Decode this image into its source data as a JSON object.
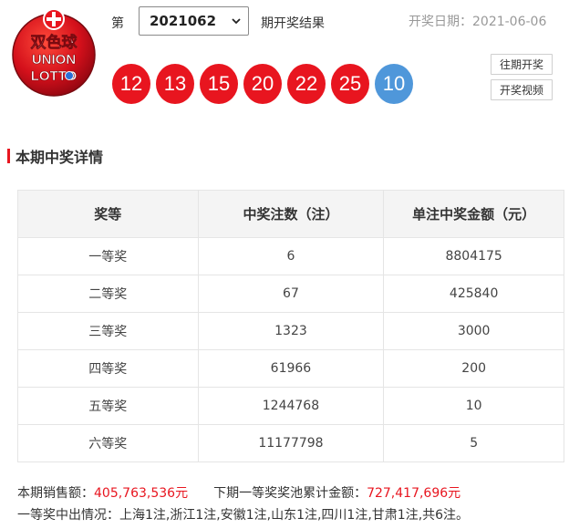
{
  "header": {
    "logo": {
      "name_cn": "双色球",
      "name_en_1": "UNION",
      "name_en_2": "LOTTO"
    },
    "issue_prefix": "第",
    "issue_value": "2021062",
    "issue_suffix": "期开奖结果",
    "draw_date_label": "开奖日期：",
    "draw_date": "2021-06-06"
  },
  "balls": {
    "red": [
      "12",
      "13",
      "15",
      "20",
      "22",
      "25"
    ],
    "blue": "10",
    "red_color": "#e8151f",
    "blue_color": "#4f97da"
  },
  "buttons": {
    "history": "往期开奖",
    "video": "开奖视频"
  },
  "section": {
    "title": "本期中奖详情"
  },
  "prize_table": {
    "headers": [
      "奖等",
      "中奖注数（注）",
      "单注中奖金额（元）"
    ],
    "rows": [
      [
        "一等奖",
        "6",
        "8804175"
      ],
      [
        "二等奖",
        "67",
        "425840"
      ],
      [
        "三等奖",
        "1323",
        "3000"
      ],
      [
        "四等奖",
        "61966",
        "200"
      ],
      [
        "五等奖",
        "1244768",
        "10"
      ],
      [
        "六等奖",
        "11177798",
        "5"
      ]
    ]
  },
  "summary": {
    "sales_label": "本期销售额：",
    "sales_value": "405,763,536元",
    "pool_label": "下期一等奖奖池累计金额：",
    "pool_value": "727,417,696元",
    "winners_text": "一等奖中出情况：上海1注,浙江1注,安徽1注,山东1注,四川1注,甘肃1注,共6注。"
  }
}
